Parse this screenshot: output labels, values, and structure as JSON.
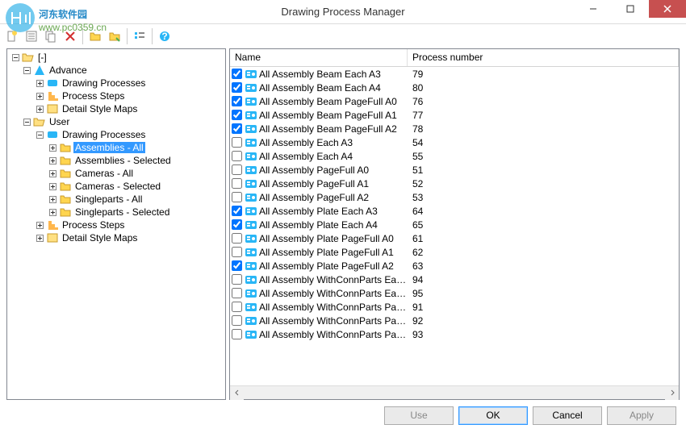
{
  "window": {
    "title": "Drawing Process Manager"
  },
  "watermark": {
    "text1": "河东软件园",
    "text2": "www.pc0359.cn"
  },
  "tree": {
    "root": "[-]",
    "advance": "Advance",
    "advance_items": {
      "dp": "Drawing Processes",
      "ps": "Process Steps",
      "dsm": "Detail Style Maps"
    },
    "user": "User",
    "user_dp": "Drawing Processes",
    "user_items": {
      "asm_all": "Assemblies - All",
      "asm_sel": "Assemblies - Selected",
      "cam_all": "Cameras - All",
      "cam_sel": "Cameras - Selected",
      "sp_all": "Singleparts - All",
      "sp_sel": "Singleparts - Selected"
    },
    "user_ps": "Process Steps",
    "user_dsm": "Detail Style Maps"
  },
  "list": {
    "col_name": "Name",
    "col_proc": "Process number",
    "rows": [
      {
        "checked": true,
        "name": "All Assembly Beam Each A3",
        "proc": "79"
      },
      {
        "checked": true,
        "name": "All Assembly Beam Each A4",
        "proc": "80"
      },
      {
        "checked": true,
        "name": "All Assembly Beam PageFull A0",
        "proc": "76"
      },
      {
        "checked": true,
        "name": "All Assembly Beam PageFull A1",
        "proc": "77"
      },
      {
        "checked": true,
        "name": "All Assembly Beam PageFull A2",
        "proc": "78"
      },
      {
        "checked": false,
        "name": "All Assembly Each A3",
        "proc": "54"
      },
      {
        "checked": false,
        "name": "All Assembly Each A4",
        "proc": "55"
      },
      {
        "checked": false,
        "name": "All Assembly PageFull A0",
        "proc": "51"
      },
      {
        "checked": false,
        "name": "All Assembly PageFull A1",
        "proc": "52"
      },
      {
        "checked": false,
        "name": "All Assembly PageFull A2",
        "proc": "53"
      },
      {
        "checked": true,
        "name": "All Assembly Plate Each A3",
        "proc": "64"
      },
      {
        "checked": true,
        "name": "All Assembly Plate Each A4",
        "proc": "65"
      },
      {
        "checked": false,
        "name": "All Assembly Plate PageFull A0",
        "proc": "61"
      },
      {
        "checked": false,
        "name": "All Assembly Plate PageFull A1",
        "proc": "62"
      },
      {
        "checked": true,
        "name": "All Assembly Plate PageFull A2",
        "proc": "63"
      },
      {
        "checked": false,
        "name": "All Assembly WithConnParts Eac...",
        "proc": "94"
      },
      {
        "checked": false,
        "name": "All Assembly WithConnParts Eac...",
        "proc": "95"
      },
      {
        "checked": false,
        "name": "All Assembly WithConnParts Pag...",
        "proc": "91"
      },
      {
        "checked": false,
        "name": "All Assembly WithConnParts Pag...",
        "proc": "92"
      },
      {
        "checked": false,
        "name": "All Assembly WithConnParts Pag...",
        "proc": "93"
      }
    ]
  },
  "buttons": {
    "use": "Use",
    "ok": "OK",
    "cancel": "Cancel",
    "apply": "Apply"
  }
}
